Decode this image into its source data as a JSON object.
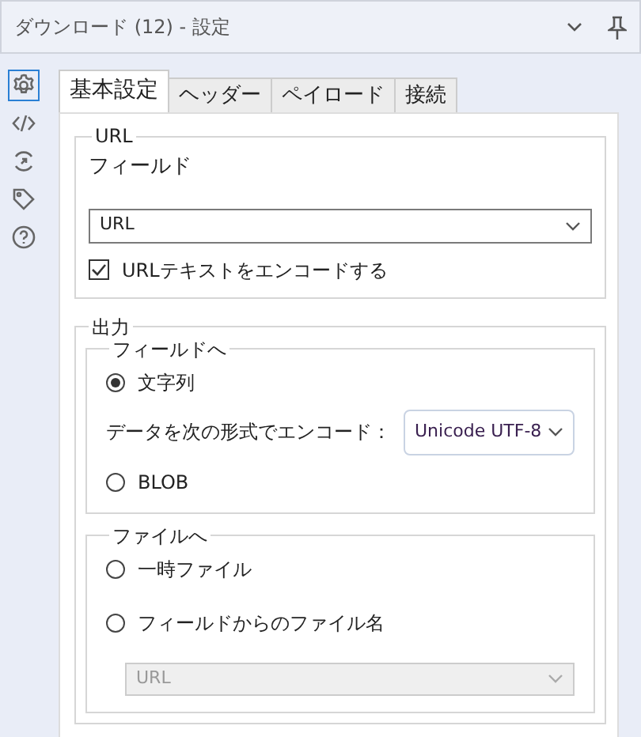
{
  "window": {
    "title": "ダウンロード (12) - 設定"
  },
  "sidebar": {
    "items": [
      {
        "kind": "gear",
        "selected": true
      },
      {
        "kind": "code",
        "selected": false
      },
      {
        "kind": "cycle",
        "selected": false
      },
      {
        "kind": "tag",
        "selected": false
      },
      {
        "kind": "help",
        "selected": false
      }
    ]
  },
  "tabs": [
    {
      "label": "基本設定",
      "selected": true
    },
    {
      "label": "ヘッダー",
      "selected": false
    },
    {
      "label": "ペイロード",
      "selected": false
    },
    {
      "label": "接続",
      "selected": false
    }
  ],
  "url_group": {
    "legend": "URL",
    "field_label": "フィールド",
    "field": {
      "value": "URL"
    },
    "encode": {
      "label": "URLテキストをエンコードする",
      "checked": true
    }
  },
  "output_group": {
    "legend": "出力",
    "to_field": {
      "legend": "フィールドへ",
      "options": [
        {
          "label": "文字列",
          "selected": true
        },
        {
          "label": "BLOB",
          "selected": false
        }
      ],
      "encoding_label": "データを次の形式でエンコード：",
      "encoding": {
        "value": "Unicode UTF-8"
      }
    },
    "to_file": {
      "legend": "ファイルへ",
      "options": [
        {
          "label": "一時ファイル",
          "selected": false
        },
        {
          "label": "フィールドからのファイル名",
          "selected": false
        }
      ],
      "filename_field": {
        "value": "URL",
        "disabled": true
      }
    }
  }
}
